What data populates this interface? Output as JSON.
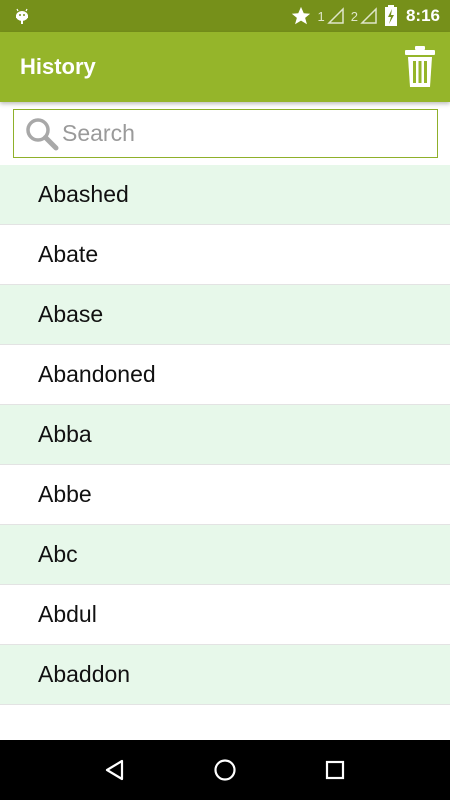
{
  "status_bar": {
    "sim1_label": "1",
    "sim2_label": "2",
    "time": "8:16"
  },
  "app_bar": {
    "title": "History",
    "action_icon": "trash-icon"
  },
  "search": {
    "placeholder": "Search",
    "value": "",
    "icon": "search-icon"
  },
  "history": {
    "items": [
      {
        "label": "Abashed"
      },
      {
        "label": "Abate"
      },
      {
        "label": "Abase"
      },
      {
        "label": "Abandoned"
      },
      {
        "label": "Abba"
      },
      {
        "label": "Abbe"
      },
      {
        "label": "Abc"
      },
      {
        "label": "Abdul"
      },
      {
        "label": "Abaddon"
      }
    ]
  },
  "colors": {
    "status_bar": "#76901a",
    "app_bar": "#95b52a",
    "row_alt": "#e7f8ea",
    "search_border": "#8fb02a"
  },
  "nav_bar": {
    "icons": [
      "back-icon",
      "home-icon",
      "recents-icon"
    ]
  }
}
